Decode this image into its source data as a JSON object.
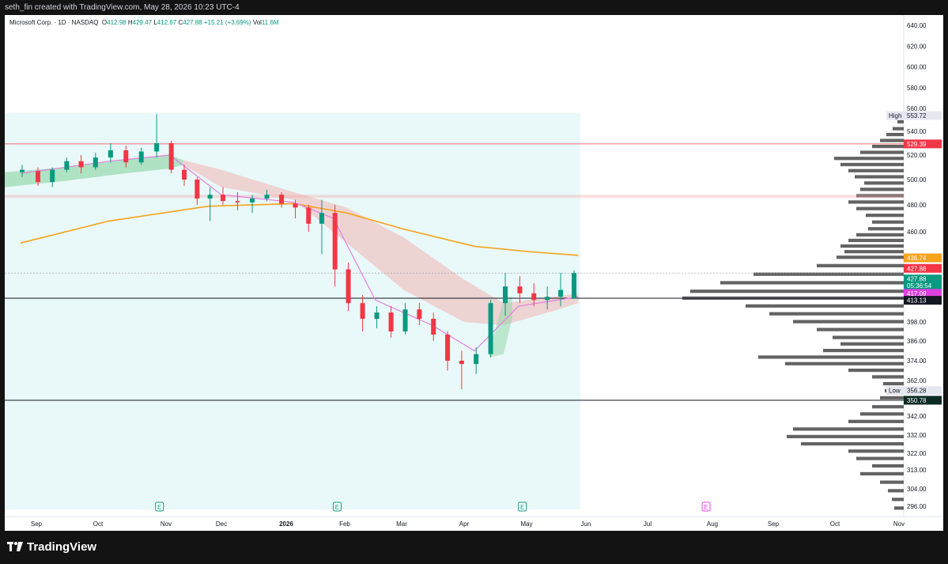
{
  "header": {
    "attribution": "seth_fin created with TradingView.com, May 28, 2026 10:23 UTC-4"
  },
  "legend": {
    "symbol": "Microsoft Corp. · 1D · NASDAQ",
    "o_label": "O",
    "o_value": "412.98",
    "h_label": "H",
    "h_value": "429.47",
    "l_label": "L",
    "l_value": "412.67",
    "c_label": "C",
    "c_value": "427.88",
    "change": "+15.21 (+3.69%)",
    "vol_label": "Vol",
    "vol_value": "11.6M"
  },
  "footer": {
    "brand": "TradingView"
  },
  "colors": {
    "up": "#089981",
    "down": "#f23645",
    "ma200": "#f7a21b",
    "ma_fast": "#e27ee0",
    "band_up": "#8fd6a6",
    "band_down": "#f4a6a6",
    "bg_shade": "#e9f8f8"
  },
  "chart_data": {
    "type": "candlestick",
    "symbol": "Microsoft Corp.",
    "interval": "1D",
    "exchange": "NASDAQ",
    "x_axis_ticks": [
      "Sep",
      "Oct",
      "Nov",
      "Dec",
      "2026",
      "Feb",
      "Mar",
      "Apr",
      "May",
      "Jun",
      "Jul",
      "Aug",
      "Sep",
      "Oct",
      "Nov"
    ],
    "y_axis_ticks": [
      296,
      304,
      313,
      322,
      332,
      342,
      362,
      374,
      386,
      398,
      460,
      480,
      500,
      520,
      540,
      560,
      580,
      600,
      620,
      640
    ],
    "ylim": [
      291,
      648
    ],
    "candles_weekly_approx": [
      {
        "date": "2025-08-25",
        "o": 506,
        "h": 512,
        "l": 502,
        "c": 508
      },
      {
        "date": "2025-09-01",
        "o": 507,
        "h": 510,
        "l": 495,
        "c": 498
      },
      {
        "date": "2025-09-08",
        "o": 498,
        "h": 510,
        "l": 494,
        "c": 508
      },
      {
        "date": "2025-09-15",
        "o": 508,
        "h": 518,
        "l": 506,
        "c": 515
      },
      {
        "date": "2025-09-22",
        "o": 515,
        "h": 520,
        "l": 505,
        "c": 510
      },
      {
        "date": "2025-09-29",
        "o": 510,
        "h": 522,
        "l": 508,
        "c": 518
      },
      {
        "date": "2025-10-06",
        "o": 518,
        "h": 530,
        "l": 514,
        "c": 524
      },
      {
        "date": "2025-10-13",
        "o": 524,
        "h": 528,
        "l": 510,
        "c": 514
      },
      {
        "date": "2025-10-20",
        "o": 514,
        "h": 526,
        "l": 512,
        "c": 523
      },
      {
        "date": "2025-10-27",
        "o": 523,
        "h": 555,
        "l": 518,
        "c": 530
      },
      {
        "date": "2025-11-03",
        "o": 530,
        "h": 532,
        "l": 505,
        "c": 508
      },
      {
        "date": "2025-11-10",
        "o": 508,
        "h": 512,
        "l": 495,
        "c": 500
      },
      {
        "date": "2025-11-17",
        "o": 500,
        "h": 502,
        "l": 480,
        "c": 485
      },
      {
        "date": "2025-11-24",
        "o": 485,
        "h": 494,
        "l": 468,
        "c": 488
      },
      {
        "date": "2025-12-01",
        "o": 488,
        "h": 494,
        "l": 480,
        "c": 483
      },
      {
        "date": "2025-12-08",
        "o": 483,
        "h": 490,
        "l": 476,
        "c": 482
      },
      {
        "date": "2025-12-15",
        "o": 482,
        "h": 488,
        "l": 474,
        "c": 485
      },
      {
        "date": "2025-12-22",
        "o": 485,
        "h": 492,
        "l": 483,
        "c": 488
      },
      {
        "date": "2025-12-29",
        "o": 488,
        "h": 490,
        "l": 478,
        "c": 481
      },
      {
        "date": "2026-01-05",
        "o": 481,
        "h": 484,
        "l": 470,
        "c": 478
      },
      {
        "date": "2026-01-12",
        "o": 478,
        "h": 480,
        "l": 460,
        "c": 466
      },
      {
        "date": "2026-01-19",
        "o": 466,
        "h": 484,
        "l": 440,
        "c": 474
      },
      {
        "date": "2026-01-26",
        "o": 474,
        "h": 480,
        "l": 420,
        "c": 430
      },
      {
        "date": "2026-02-02",
        "o": 430,
        "h": 434,
        "l": 405,
        "c": 410
      },
      {
        "date": "2026-02-09",
        "o": 410,
        "h": 415,
        "l": 392,
        "c": 400
      },
      {
        "date": "2026-02-16",
        "o": 400,
        "h": 408,
        "l": 394,
        "c": 404
      },
      {
        "date": "2026-02-23",
        "o": 404,
        "h": 408,
        "l": 388,
        "c": 392
      },
      {
        "date": "2026-03-02",
        "o": 392,
        "h": 410,
        "l": 390,
        "c": 406
      },
      {
        "date": "2026-03-09",
        "o": 406,
        "h": 410,
        "l": 396,
        "c": 400
      },
      {
        "date": "2026-03-16",
        "o": 400,
        "h": 404,
        "l": 386,
        "c": 390
      },
      {
        "date": "2026-03-23",
        "o": 390,
        "h": 392,
        "l": 368,
        "c": 374
      },
      {
        "date": "2026-03-30",
        "o": 374,
        "h": 380,
        "l": 357,
        "c": 372
      },
      {
        "date": "2026-04-06",
        "o": 372,
        "h": 382,
        "l": 366,
        "c": 378
      },
      {
        "date": "2026-04-13",
        "o": 378,
        "h": 412,
        "l": 376,
        "c": 410
      },
      {
        "date": "2026-04-20",
        "o": 410,
        "h": 428,
        "l": 402,
        "c": 420
      },
      {
        "date": "2026-04-27",
        "o": 420,
        "h": 426,
        "l": 410,
        "c": 416
      },
      {
        "date": "2026-05-04",
        "o": 416,
        "h": 422,
        "l": 408,
        "c": 412
      },
      {
        "date": "2026-05-11",
        "o": 412,
        "h": 420,
        "l": 406,
        "c": 414
      },
      {
        "date": "2026-05-18",
        "o": 414,
        "h": 428,
        "l": 408,
        "c": 418
      },
      {
        "date": "2026-05-25",
        "o": 412.98,
        "h": 429.47,
        "l": 412.67,
        "c": 427.88
      }
    ],
    "ma200": [
      {
        "date": "2025-08-25",
        "v": 450
      },
      {
        "date": "2025-10-06",
        "v": 468
      },
      {
        "date": "2025-11-24",
        "v": 479
      },
      {
        "date": "2026-01-05",
        "v": 481
      },
      {
        "date": "2026-02-02",
        "v": 474
      },
      {
        "date": "2026-03-02",
        "v": 462
      },
      {
        "date": "2026-04-06",
        "v": 447
      },
      {
        "date": "2026-05-04",
        "v": 442
      },
      {
        "date": "2026-05-28",
        "v": 439
      }
    ],
    "ma_fast": [
      {
        "date": "2025-08-25",
        "v": 505
      },
      {
        "date": "2025-10-06",
        "v": 515
      },
      {
        "date": "2025-11-03",
        "v": 520
      },
      {
        "date": "2025-12-01",
        "v": 488
      },
      {
        "date": "2026-01-05",
        "v": 482
      },
      {
        "date": "2026-01-26",
        "v": 470
      },
      {
        "date": "2026-02-16",
        "v": 412
      },
      {
        "date": "2026-03-16",
        "v": 396
      },
      {
        "date": "2026-04-06",
        "v": 380
      },
      {
        "date": "2026-04-27",
        "v": 408
      },
      {
        "date": "2026-05-28",
        "v": 414
      }
    ],
    "horizontal_lines": [
      {
        "price": 529.39,
        "color": "#f23645"
      },
      {
        "price": 413.13,
        "color": "#131722"
      },
      {
        "price": 350.78,
        "color": "#131722"
      }
    ],
    "price_labels": [
      {
        "text": "High",
        "value": "553.72",
        "bg": "#e6e8ef",
        "fg": "#131722",
        "price": 553.72
      },
      {
        "text": "",
        "value": "529.39",
        "bg": "#f23645",
        "fg": "#ffffff",
        "price": 529.39
      },
      {
        "text": "",
        "value": "436.74",
        "bg": "#f7a21b",
        "fg": "#ffffff",
        "price": 436.74
      },
      {
        "text": "",
        "value": "427.88",
        "bg": "#f23645",
        "fg": "#ffffff",
        "price": 430.6
      },
      {
        "text": "",
        "value": "427.88",
        "bg": "#089981",
        "fg": "#ffffff",
        "price": 424.4
      },
      {
        "text": "",
        "value": "05:36:54",
        "bg": "#089981",
        "fg": "#ffffff",
        "price": 420.6
      },
      {
        "text": "",
        "value": "417.09",
        "bg": "#e040e0",
        "fg": "#ffffff",
        "price": 416.0
      },
      {
        "text": "",
        "value": "413.13",
        "bg": "#131722",
        "fg": "#ffffff",
        "price": 411.8
      },
      {
        "text": "Low",
        "value": "356.28",
        "bg": "#e6e8ef",
        "fg": "#131722",
        "price": 356.28
      },
      {
        "text": "",
        "value": "350.78",
        "bg": "#0b2b24",
        "fg": "#ffffff",
        "price": 350.78
      }
    ],
    "earnings_markers": [
      {
        "date": "2025-10-29",
        "label": "E"
      },
      {
        "date": "2026-01-28",
        "label": "E"
      },
      {
        "date": "2026-04-29",
        "label": "E"
      },
      {
        "date": "2026-07-29",
        "label": "E"
      }
    ],
    "volume_profile": [
      {
        "price": 548,
        "w": 8
      },
      {
        "price": 542,
        "w": 14
      },
      {
        "price": 537,
        "w": 22
      },
      {
        "price": 532,
        "w": 30
      },
      {
        "price": 527,
        "w": 40
      },
      {
        "price": 522,
        "w": 55
      },
      {
        "price": 517,
        "w": 88
      },
      {
        "price": 512,
        "w": 80
      },
      {
        "price": 507,
        "w": 70
      },
      {
        "price": 502,
        "w": 62
      },
      {
        "price": 497,
        "w": 50
      },
      {
        "price": 492,
        "w": 55
      },
      {
        "price": 487,
        "w": 60
      },
      {
        "price": 482,
        "w": 70
      },
      {
        "price": 477,
        "w": 60
      },
      {
        "price": 472,
        "w": 48
      },
      {
        "price": 467,
        "w": 40
      },
      {
        "price": 462,
        "w": 45
      },
      {
        "price": 457,
        "w": 60
      },
      {
        "price": 452,
        "w": 70
      },
      {
        "price": 447,
        "w": 80
      },
      {
        "price": 442,
        "w": 75
      },
      {
        "price": 437,
        "w": 85
      },
      {
        "price": 432,
        "w": 110
      },
      {
        "price": 427,
        "w": 190
      },
      {
        "price": 422,
        "w": 232
      },
      {
        "price": 417,
        "w": 270
      },
      {
        "price": 413,
        "w": 280
      },
      {
        "price": 408,
        "w": 200
      },
      {
        "price": 403,
        "w": 170
      },
      {
        "price": 398,
        "w": 140
      },
      {
        "price": 393,
        "w": 110
      },
      {
        "price": 388,
        "w": 90
      },
      {
        "price": 384,
        "w": 80
      },
      {
        "price": 380,
        "w": 102
      },
      {
        "price": 376,
        "w": 184
      },
      {
        "price": 372,
        "w": 150
      },
      {
        "price": 368,
        "w": 70
      },
      {
        "price": 364,
        "w": 40
      },
      {
        "price": 360,
        "w": 26
      },
      {
        "price": 356,
        "w": 24
      },
      {
        "price": 352,
        "w": 30
      },
      {
        "price": 347,
        "w": 40
      },
      {
        "price": 343,
        "w": 55
      },
      {
        "price": 339,
        "w": 70
      },
      {
        "price": 335,
        "w": 140
      },
      {
        "price": 331,
        "w": 148
      },
      {
        "price": 327,
        "w": 130
      },
      {
        "price": 323,
        "w": 70
      },
      {
        "price": 319,
        "w": 60
      },
      {
        "price": 315,
        "w": 40
      },
      {
        "price": 311,
        "w": 55
      },
      {
        "price": 307,
        "w": 30
      },
      {
        "price": 303,
        "w": 20
      },
      {
        "price": 299,
        "w": 15
      },
      {
        "price": 295,
        "w": 12
      }
    ]
  }
}
